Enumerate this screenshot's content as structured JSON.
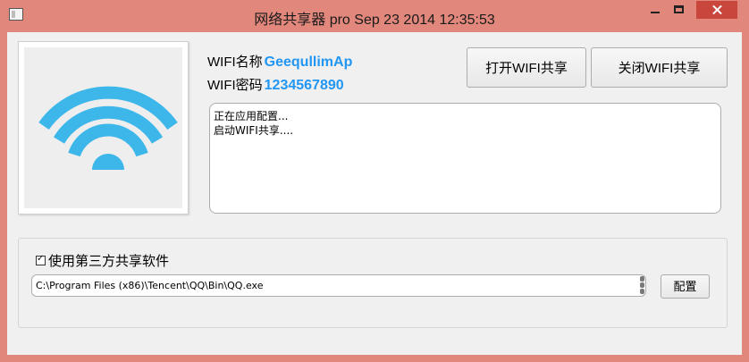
{
  "window": {
    "title": "网络共享器 pro Sep 23 2014 12:35:53"
  },
  "colors": {
    "titlebar": "#e1877c",
    "close_button": "#c9463d",
    "accent_blue": "#2196f3",
    "wifi_icon": "#3db7ea"
  },
  "wifi_info": {
    "name_label": "WIFI名称",
    "name_value": "GeequllimAp",
    "password_label": "WIFI密码",
    "password_value": "1234567890"
  },
  "buttons": {
    "open_share": "打开WIFI共享",
    "close_share": "关闭WIFI共享",
    "configure": "配置"
  },
  "log": {
    "lines": [
      "正在应用配置...",
      "启动WIFI共享...."
    ]
  },
  "third_party": {
    "checkbox_label": "使用第三方共享软件",
    "checked": true,
    "path_value": "C:\\Program Files (x86)\\Tencent\\QQ\\Bin\\QQ.exe"
  }
}
